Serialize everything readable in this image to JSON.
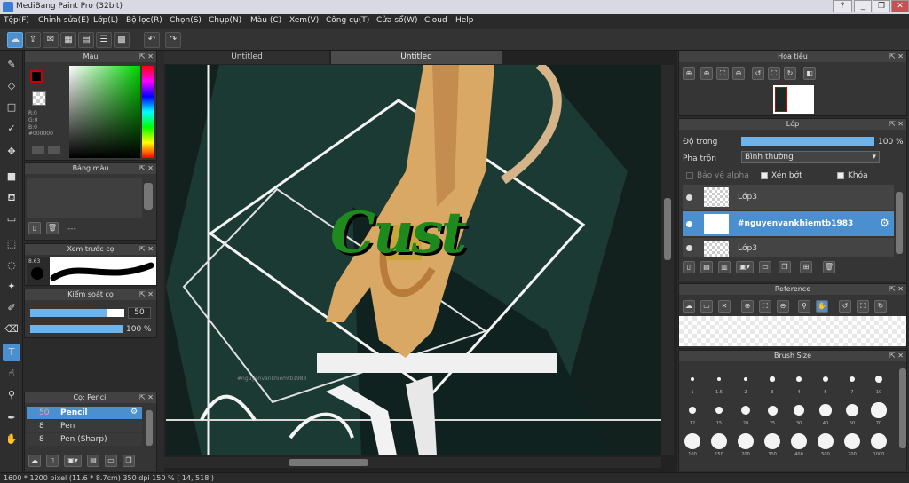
{
  "window": {
    "title": "MediBang Paint Pro (32bit)"
  },
  "menu": [
    "Tệp(F)",
    "Chỉnh sửa(E)",
    "Lớp(L)",
    "Bộ lọc(R)",
    "Chọn(S)",
    "Chụp(N)",
    "Màu (C)",
    "Xem(V)",
    "Công cụ(T)",
    "Cửa sổ(W)",
    "Cloud",
    "Help"
  ],
  "color_panel": {
    "title": "Màu",
    "r": "R:0",
    "g": "G:0",
    "b": "B:0",
    "hex": "#000000"
  },
  "palette_panel": {
    "title": "Bảng màu",
    "dash": "---"
  },
  "brush_preview": {
    "title": "Xem trước cọ",
    "size": "8.63"
  },
  "brush_control": {
    "title": "Kiểm soát cọ",
    "size_value": "50",
    "size_fraction": 0.82,
    "opacity_value": "100 %",
    "opacity_fraction": 1.0
  },
  "brush_list": {
    "title": "Cọ: Pencil",
    "items": [
      {
        "size": "50",
        "name": "Pencil"
      },
      {
        "size": "8",
        "name": "Pen"
      },
      {
        "size": "8",
        "name": "Pen (Sharp)"
      }
    ]
  },
  "canvas": {
    "tabs": [
      "Untitled",
      "Untitled"
    ],
    "art_text": "Cust",
    "watermark": "#nguyenvankhiemtb1983"
  },
  "navigator": {
    "title": "Hoa tiêu"
  },
  "layer_panel": {
    "title": "Lớp",
    "opacity_label": "Độ trong",
    "opacity_value": "100 %",
    "blend_label": "Pha trộn",
    "blend_value": "Bình thường",
    "protect_alpha": "Bảo vệ alpha",
    "clipping": "Xén bớt",
    "lock": "Khóa",
    "layers": [
      "Lớp3",
      "#nguyenvankhiemtb1983",
      "Lớp3"
    ]
  },
  "reference_panel": {
    "title": "Reference"
  },
  "brush_size_panel": {
    "title": "Brush Size",
    "sizes": [
      "1",
      "1.5",
      "2",
      "3",
      "4",
      "5",
      "7",
      "10",
      "12",
      "15",
      "20",
      "25",
      "30",
      "40",
      "50",
      "70",
      "100",
      "150",
      "200",
      "300",
      "400",
      "500",
      "700",
      "1000"
    ]
  },
  "status": {
    "text": "1600 * 1200 pixel   (11.6 * 8.7cm)   350 dpi   150 %   ( 14, 518 )"
  },
  "colors": {
    "accent": "#4a8fd0",
    "panel": "#353535",
    "header": "#424242"
  }
}
